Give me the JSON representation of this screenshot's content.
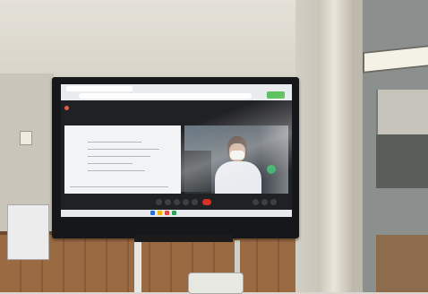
{
  "scene": {
    "description_colors": {
      "wall": "#d7d3c8",
      "wood_panel": "#9a6a43",
      "tv_bezel": "#15171a",
      "meet_background": "#202124",
      "hangup_red": "#d93025",
      "accent_green": "#5cc25e"
    }
  },
  "meet": {
    "hangup_icon": "phone-hangup-icon",
    "mic_icon": "mic-icon",
    "camera_icon": "camera-icon"
  }
}
